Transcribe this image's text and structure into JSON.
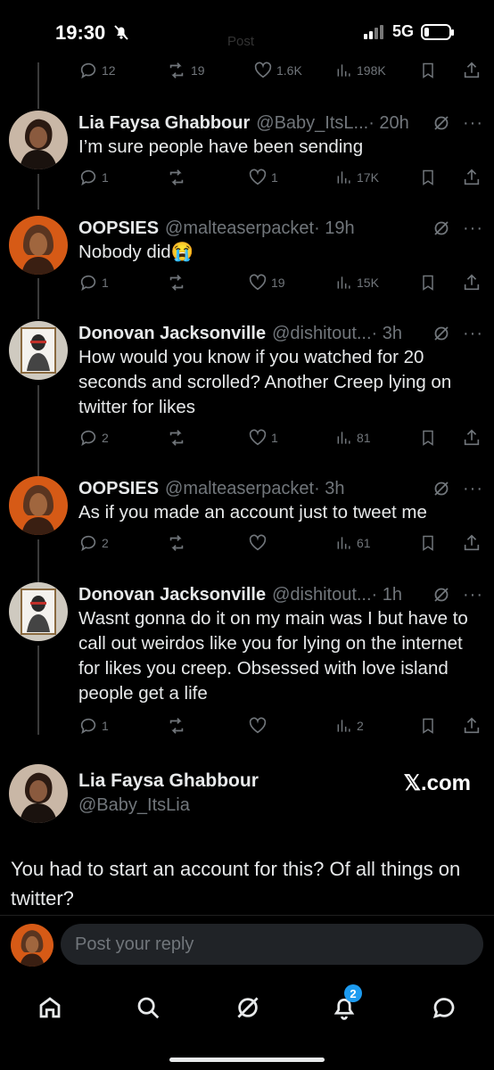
{
  "status_bar": {
    "time": "19:30",
    "network": "5G",
    "battery_level": 0.2
  },
  "header": {
    "title": "Post"
  },
  "top_partial_actions": {
    "replies": "12",
    "reposts": "19",
    "likes": "1.6K",
    "views": "198K"
  },
  "tweets": [
    {
      "name": "Lia Faysa Ghabbour",
      "handle": "@Baby_ItsL...",
      "time": "· 20h",
      "text": "I’m sure people have been sending",
      "replies": "1",
      "reposts": "",
      "likes": "1",
      "views": "17K"
    },
    {
      "name": "OOPSIES",
      "handle": "@malteaserpacket",
      "time": "· 19h",
      "text": "Nobody did😭",
      "replies": "1",
      "reposts": "",
      "likes": "19",
      "views": "15K"
    },
    {
      "name": "Donovan Jacksonville",
      "handle": "@dishitout...",
      "time": "· 3h",
      "text": "How would you know if you watched for 20 seconds and scrolled? Another Creep lying on twitter for likes",
      "replies": "2",
      "reposts": "",
      "likes": "1",
      "views": "81"
    },
    {
      "name": "OOPSIES",
      "handle": "@malteaserpacket",
      "time": "· 3h",
      "text": "As if you made an account just to tweet me",
      "replies": "2",
      "reposts": "",
      "likes": "",
      "views": "61"
    },
    {
      "name": "Donovan Jacksonville",
      "handle": "@dishitout...",
      "time": "· 1h",
      "text": "Wasnt gonna do it on my main was I but have to call out weirdos like you for lying on the internet for likes you creep. Obsessed with love island people get a life",
      "replies": "1",
      "reposts": "",
      "likes": "",
      "views": "2"
    }
  ],
  "more_label": "···",
  "quoted": {
    "name": "Lia Faysa Ghabbour",
    "handle": "@Baby_ItsLia",
    "brand": "𝕏.com",
    "text": "You had to start an account for this? Of all things on twitter?"
  },
  "reply": {
    "placeholder": "Post your reply"
  },
  "nav": {
    "notifications_badge": "2"
  },
  "colors": {
    "background": "#000000",
    "text": "#e7e9ea",
    "muted": "#71767b",
    "accent": "#1d9bf0"
  }
}
